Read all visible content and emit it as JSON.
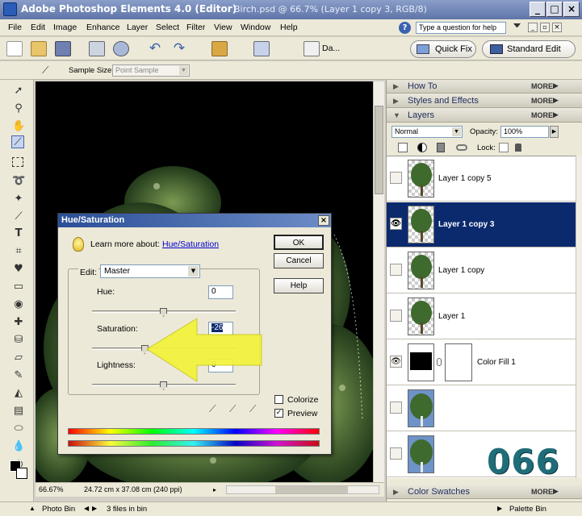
{
  "window": {
    "app_title": "Adobe Photoshop Elements 4.0 (Editor)",
    "doc_title": "Birch.psd @ 66.7% (Layer 1 copy 3, RGB/8)"
  },
  "menubar": {
    "items": [
      "File",
      "Edit",
      "Image",
      "Enhance",
      "Layer",
      "Select",
      "Filter",
      "View",
      "Window",
      "Help"
    ],
    "help_placeholder": "Type a question for help"
  },
  "toolbar": {
    "date_label": "Da...",
    "quick_fix_label": "Quick Fix",
    "standard_edit_label": "Standard Edit"
  },
  "options": {
    "sample_size_label": "Sample Size:",
    "sample_size_value": "Point Sample"
  },
  "status": {
    "zoom": "66.67%",
    "doc_size": "24.72 cm x 37.08 cm (240 ppi)"
  },
  "palette_bin": {
    "how_to": "How To",
    "styles_effects": "Styles and Effects",
    "layers": "Layers",
    "color_swatches": "Color Swatches",
    "more_label": "MORE",
    "blend_mode": "Normal",
    "opacity_label": "Opacity:",
    "opacity_value": "100%",
    "lock_label": "Lock:",
    "layers_list": [
      {
        "name": "Layer 1 copy 5",
        "visible": false,
        "selected": false
      },
      {
        "name": "Layer 1 copy 3",
        "visible": true,
        "selected": true
      },
      {
        "name": "Layer 1 copy",
        "visible": false,
        "selected": false
      },
      {
        "name": "Layer 1",
        "visible": false,
        "selected": false
      },
      {
        "name": "Color Fill 1",
        "visible": true,
        "selected": false
      }
    ]
  },
  "dialog": {
    "title": "Hue/Saturation",
    "learn_more_label": "Learn more about:",
    "learn_more_link": "Hue/Saturation",
    "edit_label": "Edit:",
    "edit_value": "Master",
    "hue_label": "Hue:",
    "hue_value": "0",
    "hue_level": 0.5,
    "saturation_label": "Saturation:",
    "saturation_value": "-26",
    "saturation_level": 0.37,
    "lightness_label": "Lightness:",
    "lightness_value": "0",
    "lightness_level": 0.5,
    "ok_label": "OK",
    "cancel_label": "Cancel",
    "help_label": "Help",
    "colorize_label": "Colorize",
    "colorize_checked": false,
    "preview_label": "Preview",
    "preview_checked": true
  },
  "bottom": {
    "photo_bin": "Photo Bin",
    "files_in_bin": "3 files in bin",
    "palette_bin": "Palette Bin"
  },
  "brand_number": "066",
  "colors": {
    "title_bar": "#5f75a8",
    "selected_layer": "#0b2a6e",
    "arrow": "#f2f23a",
    "brand": "#1f6d78"
  }
}
